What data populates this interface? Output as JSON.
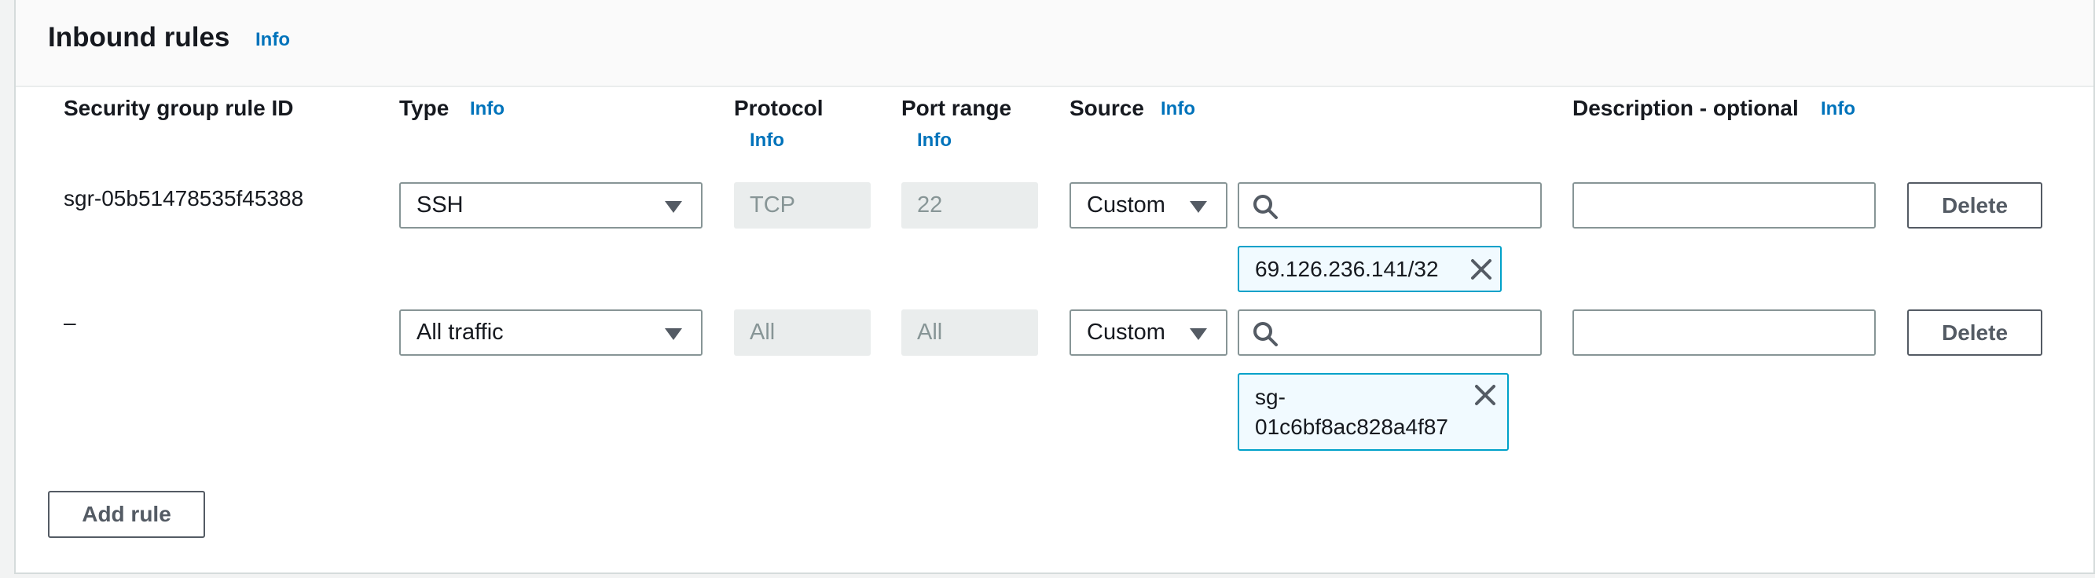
{
  "section": {
    "title": "Inbound rules",
    "info": "Info"
  },
  "columns": {
    "rule_id": "Security group rule ID",
    "type": "Type",
    "type_info": "Info",
    "protocol": "Protocol",
    "protocol_info": "Info",
    "port_range": "Port range",
    "port_range_info": "Info",
    "source": "Source",
    "source_info": "Info",
    "description": "Description - optional",
    "description_info": "Info"
  },
  "rules": [
    {
      "rule_id": "sgr-05b51478535f45388",
      "type": "SSH",
      "protocol": "TCP",
      "port_range": "22",
      "source_type": "Custom",
      "source_search_value": "",
      "source_token": "69.126.236.141/32",
      "description": "",
      "delete_label": "Delete"
    },
    {
      "rule_id": "–",
      "type": "All traffic",
      "protocol": "All",
      "port_range": "All",
      "source_type": "Custom",
      "source_search_value": "",
      "source_token_line1": "sg-",
      "source_token_line2": "01c6bf8ac828a4f87",
      "description": "",
      "delete_label": "Delete"
    }
  ],
  "add_rule_label": "Add rule",
  "icons": {
    "select_caret": "caret-down-icon",
    "search": "search-icon",
    "remove_token": "close-icon"
  },
  "colors": {
    "link": "#0073bb",
    "token_border": "#00a1c9",
    "token_bg": "#f1faff",
    "disabled_bg": "#eaeded"
  }
}
